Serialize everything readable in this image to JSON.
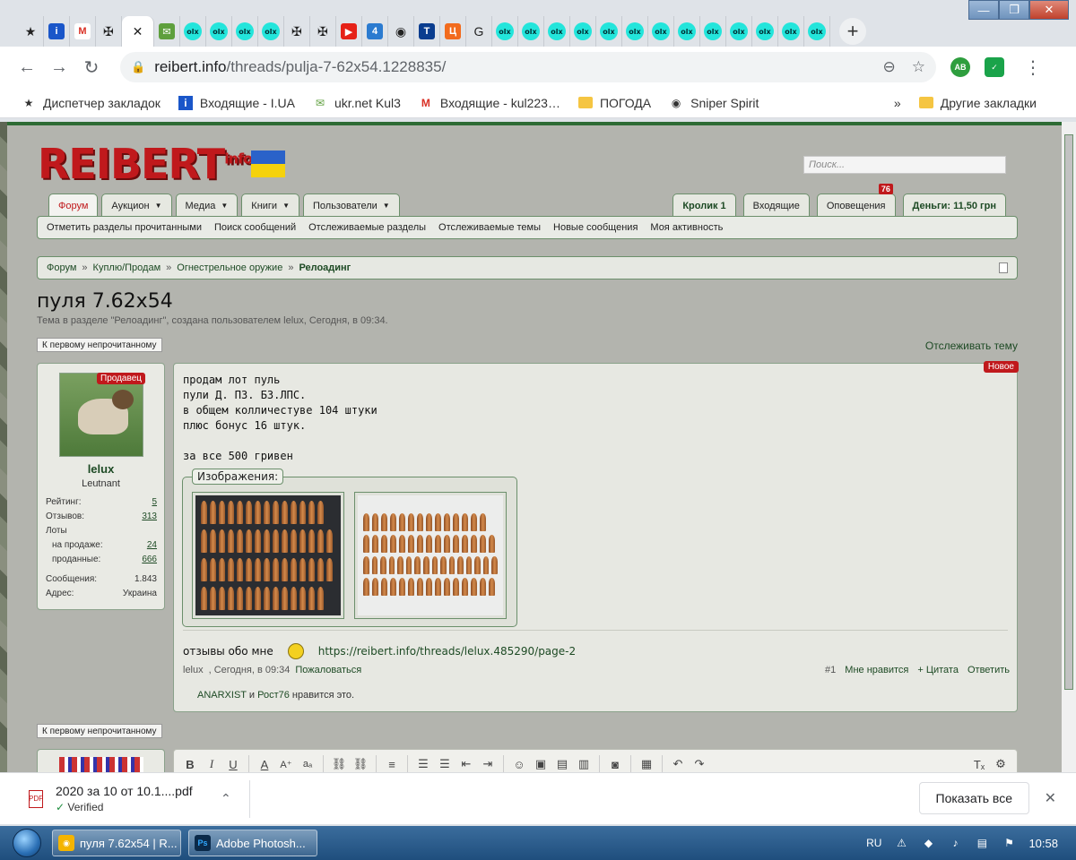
{
  "browser": {
    "url_host": "reibert.info",
    "url_path": "/threads/pulja-7-62x54.1228835/",
    "tabs": [
      "★",
      "i",
      "M",
      "✠",
      "✕",
      "✉",
      "olx",
      "olx",
      "olx",
      "olx",
      "✠",
      "✠",
      "▶",
      "4",
      "◉",
      "T",
      "Ц",
      "G",
      "olx",
      "olx",
      "olx",
      "olx",
      "olx",
      "olx",
      "olx",
      "olx",
      "olx",
      "olx",
      "olx",
      "olx",
      "olx"
    ],
    "bookmarks": [
      {
        "icon": "star-icon",
        "glyph": "★",
        "label": "Диспетчер закладок"
      },
      {
        "icon": "info-icon",
        "glyph": "i",
        "label": "Входящие - I.UA"
      },
      {
        "icon": "mail-icon",
        "glyph": "✉",
        "label": "ukr.net  Kul3"
      },
      {
        "icon": "gmail-icon",
        "glyph": "M",
        "label": "Входящие - kul223…"
      },
      {
        "icon": "folder-icon",
        "glyph": "",
        "label": "ПОГОДА"
      },
      {
        "icon": "globe-icon",
        "glyph": "◉",
        "label": "Sniper Spirit"
      }
    ],
    "more_bookmarks": "»",
    "other_bookmarks": "Другие закладки",
    "ext_ab": "AB"
  },
  "site": {
    "logo": "REIBERT",
    "logo_suffix": "info",
    "search_placeholder": "Поиск...",
    "nav_tabs": [
      {
        "label": "Форум",
        "caret": false
      },
      {
        "label": "Аукцион",
        "caret": true
      },
      {
        "label": "Медиа",
        "caret": true
      },
      {
        "label": "Книги",
        "caret": true
      },
      {
        "label": "Пользователи",
        "caret": true
      }
    ],
    "user_tabs": {
      "account": "Кролик 1",
      "inbox": "Входящие",
      "alerts": "Оповещения",
      "alerts_count": "76",
      "money": "Деньги: 11,50 грн"
    },
    "subnav": [
      "Отметить разделы прочитанными",
      "Поиск сообщений",
      "Отслеживаемые разделы",
      "Отслеживаемые темы",
      "Новые сообщения",
      "Моя активность"
    ],
    "breadcrumb": [
      "Форум",
      "Куплю/Продам",
      "Огнестрельное оружие"
    ],
    "breadcrumb_sep": "»",
    "breadcrumb_current": "Релоадинг"
  },
  "thread": {
    "title": "пуля 7.62х54",
    "meta": "Тема в разделе \"Релоадинг\", создана пользователем lelux, Сегодня, в 09:34.",
    "first_unread": "К первому непрочитанному",
    "watch": "Отслеживать тему"
  },
  "post": {
    "user": {
      "name": "lelux",
      "title": "Leutnant",
      "badge": "Продавец",
      "stats": [
        {
          "label": "Рейтинг:",
          "value": "5",
          "link": true,
          "indent": false
        },
        {
          "label": "Отзывов:",
          "value": "313",
          "link": true,
          "indent": false
        },
        {
          "label": "Лоты",
          "value": "",
          "link": false,
          "indent": false
        },
        {
          "label": "на продаже:",
          "value": "24",
          "link": true,
          "indent": true
        },
        {
          "label": "проданные:",
          "value": "666",
          "link": true,
          "indent": true
        },
        {
          "label": "",
          "value": "",
          "link": false,
          "indent": false
        },
        {
          "label": "Сообщения:",
          "value": "1.843",
          "link": false,
          "indent": false
        },
        {
          "label": "Адрес:",
          "value": "Украина",
          "link": false,
          "indent": false
        }
      ]
    },
    "new_badge": "Новое",
    "message": "продам лот пуль\nпули Д. ПЗ. БЗ.ЛПС.\nв общем колличестуве 104 штуки\nплюс бонус 16 штук.\n\nза все 500 гривен",
    "attachments_label": "Изображения:",
    "feedback_prefix": "отзывы обо мне",
    "feedback_link": "https://reibert.info/threads/lelux.485290/page-2",
    "footer": {
      "author": "lelux",
      "time": "Сегодня, в 09:34",
      "report": "Пожаловаться",
      "number": "#1",
      "like": "Мне нравится",
      "quote": "+ Цитата",
      "reply": "Ответить"
    },
    "likes": {
      "user1": "ANARXIST",
      "and": "и",
      "user2": "Рост76",
      "suffix": "нравится это."
    }
  },
  "downloads": {
    "file": "2020 за 10 от 10.1....pdf",
    "status": "Verified",
    "show_all": "Показать все"
  },
  "taskbar": {
    "tasks": [
      {
        "label": "пуля 7.62х54 | R...",
        "icon_text": "◉",
        "color": "#f4b400"
      },
      {
        "label": "Adobe Photosh...",
        "icon_text": "Ps",
        "color": "#0b2a4a"
      }
    ],
    "lang": "RU",
    "time": "10:58"
  },
  "colors": {
    "site_green": "#1d4a24",
    "logo_red": "#c0191c",
    "flag_blue": "#2a62c9",
    "flag_yellow": "#f5d20c"
  }
}
